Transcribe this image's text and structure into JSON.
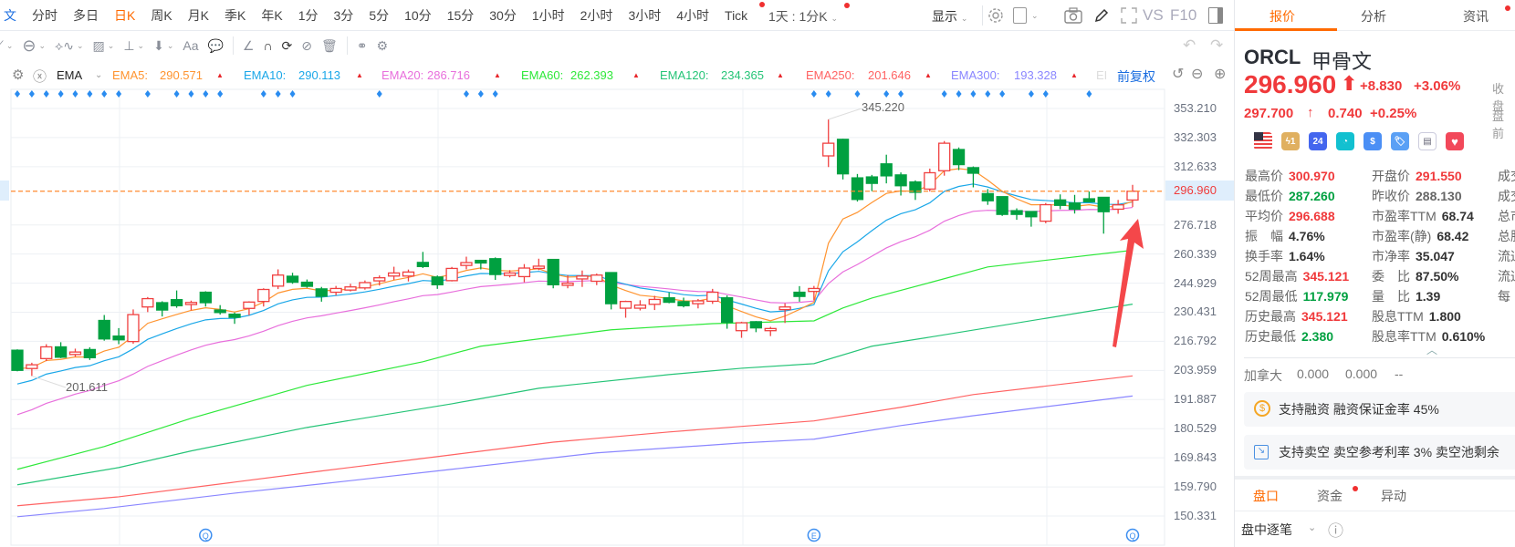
{
  "topbar": {
    "periods": [
      "文",
      "分时",
      "多日",
      "日K",
      "周K",
      "月K",
      "季K",
      "年K",
      "1分",
      "3分",
      "5分",
      "10分",
      "15分",
      "30分",
      "1小时",
      "2小时",
      "3小时",
      "4小时",
      "Tick"
    ],
    "active": "日K",
    "session": "1天 : 1分K",
    "display_label": "显示",
    "vs_label": "VS",
    "f10_label": "F10"
  },
  "toolbar": {
    "text_tool": "Aa"
  },
  "ema_legend": {
    "indicator": "EMA",
    "items": [
      {
        "label": "EMA5:",
        "value": "290.571",
        "color": "#ff9430"
      },
      {
        "label": "EMA10:",
        "value": "290.113",
        "color": "#1aa7e8"
      },
      {
        "label": "EMA20:",
        "value": "286.716",
        "color": "#e86fdc"
      },
      {
        "label": "EMA60:",
        "value": "262.393",
        "color": "#2ee83a"
      },
      {
        "label": "EMA120:",
        "value": "234.365",
        "color": "#25c477"
      },
      {
        "label": "EMA250:",
        "value": "201.646",
        "color": "#ff6262"
      },
      {
        "label": "EMA300:",
        "value": "193.328",
        "color": "#8a86ff"
      }
    ],
    "truncated": "EI",
    "adjust_label": "前复权"
  },
  "chart_data": {
    "type": "candlestick",
    "y_scale": "log",
    "ylim": [
      150.331,
      353.21
    ],
    "y_ticks": [
      "353.210",
      "332.303",
      "312.633",
      "276.718",
      "260.339",
      "244.929",
      "230.431",
      "216.792",
      "203.959",
      "191.887",
      "180.529",
      "169.843",
      "159.790",
      "150.331"
    ],
    "current_price": "296.960",
    "high_label": "345.220",
    "low_label": "201.611",
    "colors": {
      "up": "#f04040",
      "down": "#00a040",
      "current_line": "#ff8a30"
    },
    "candles_ohlc": [
      [
        212.8,
        213.2,
        203.6,
        204.0
      ],
      [
        204.8,
        207.3,
        201.611,
        206.4
      ],
      [
        209.1,
        215.5,
        208.0,
        214.3
      ],
      [
        214.3,
        216.4,
        209.3,
        209.7
      ],
      [
        210.9,
        213.5,
        209.9,
        212.0
      ],
      [
        213.1,
        214.1,
        208.5,
        209.5
      ],
      [
        226.5,
        229.1,
        217.1,
        217.9
      ],
      [
        219.2,
        222.9,
        215.5,
        217.5
      ],
      [
        216.7,
        231.8,
        215.7,
        229.3
      ],
      [
        233.0,
        237.9,
        230.5,
        237.1
      ],
      [
        235.1,
        235.8,
        228.4,
        231.5
      ],
      [
        236.6,
        241.2,
        232.6,
        233.6
      ],
      [
        234.2,
        236.1,
        231.3,
        235.2
      ],
      [
        240.3,
        240.8,
        233.2,
        235.1
      ],
      [
        231.5,
        233.9,
        229.3,
        230.3
      ],
      [
        229.5,
        230.3,
        224.9,
        228.0
      ],
      [
        232.3,
        235.8,
        229.0,
        235.4
      ],
      [
        235.7,
        242.3,
        233.2,
        241.7
      ],
      [
        243.4,
        252.1,
        241.9,
        249.1
      ],
      [
        248.5,
        250.3,
        244.6,
        245.4
      ],
      [
        245.4,
        246.8,
        242.6,
        243.3
      ],
      [
        242.0,
        243.0,
        235.6,
        238.3
      ],
      [
        240.3,
        243.5,
        238.7,
        242.2
      ],
      [
        241.4,
        244.6,
        240.7,
        243.0
      ],
      [
        242.5,
        246.3,
        241.6,
        245.2
      ],
      [
        246.1,
        248.9,
        243.7,
        247.7
      ],
      [
        248.6,
        253.5,
        246.6,
        250.2
      ],
      [
        248.6,
        252.0,
        245.8,
        250.7
      ],
      [
        255.8,
        261.5,
        252.8,
        253.6
      ],
      [
        248.1,
        248.9,
        242.0,
        244.1
      ],
      [
        246.2,
        253.4,
        245.8,
        252.6
      ],
      [
        254.2,
        258.9,
        252.1,
        255.7
      ],
      [
        256.9,
        256.9,
        252.1,
        255.5
      ],
      [
        257.8,
        258.5,
        246.6,
        249.4
      ],
      [
        248.9,
        251.7,
        247.9,
        250.2
      ],
      [
        248.3,
        254.9,
        245.4,
        252.8
      ],
      [
        252.6,
        257.8,
        251.7,
        253.8
      ],
      [
        257.4,
        257.6,
        242.3,
        244.1
      ],
      [
        243.8,
        249.1,
        242.3,
        244.9
      ],
      [
        247.1,
        251.5,
        243.0,
        248.6
      ],
      [
        245.9,
        249.9,
        243.9,
        249.1
      ],
      [
        250.4,
        250.4,
        231.8,
        234.6
      ],
      [
        232.4,
        236.1,
        227.8,
        235.7
      ],
      [
        232.4,
        236.3,
        231.3,
        233.9
      ],
      [
        234.3,
        238.5,
        231.5,
        236.7
      ],
      [
        237.5,
        240.2,
        234.8,
        235.3
      ],
      [
        235.6,
        237.6,
        232.8,
        233.6
      ],
      [
        234.6,
        236.9,
        232.3,
        236.0
      ],
      [
        235.8,
        242.0,
        234.5,
        240.3
      ],
      [
        237.5,
        238.7,
        222.6,
        225.6
      ],
      [
        221.7,
        225.9,
        218.4,
        225.4
      ],
      [
        225.9,
        226.2,
        221.0,
        223.0
      ],
      [
        221.7,
        223.5,
        219.2,
        222.7
      ],
      [
        231.7,
        234.8,
        225.3,
        233.0
      ],
      [
        240.3,
        243.4,
        235.6,
        238.2
      ],
      [
        240.7,
        243.5,
        236.3,
        242.2
      ],
      [
        319.8,
        345.22,
        312.4,
        328.4
      ],
      [
        331.1,
        331.5,
        304.4,
        308.0
      ],
      [
        305.4,
        307.9,
        290.6,
        291.9
      ],
      [
        306.0,
        307.3,
        297.0,
        301.9
      ],
      [
        314.5,
        320.6,
        301.9,
        306.7
      ],
      [
        307.3,
        308.9,
        294.3,
        300.4
      ],
      [
        302.8,
        303.8,
        291.6,
        296.3
      ],
      [
        298.3,
        311.4,
        296.8,
        308.7
      ],
      [
        310.0,
        329.9,
        306.8,
        328.4
      ],
      [
        324.1,
        325.5,
        310.4,
        314.0
      ],
      [
        312.0,
        312.8,
        299.4,
        308.4
      ],
      [
        295.5,
        298.3,
        288.6,
        291.1
      ],
      [
        293.6,
        293.6,
        282.0,
        282.9
      ],
      [
        285.1,
        286.5,
        279.7,
        282.9
      ],
      [
        284.6,
        284.6,
        275.7,
        281.5
      ],
      [
        278.9,
        289.7,
        277.7,
        288.7
      ],
      [
        291.6,
        295.0,
        286.0,
        288.3
      ],
      [
        289.7,
        294.7,
        283.4,
        286.0
      ],
      [
        292.3,
        296.8,
        290.5,
        290.5
      ],
      [
        293.2,
        293.2,
        271.7,
        284.5
      ],
      [
        286.0,
        291.6,
        283.3,
        288.6
      ],
      [
        291.55,
        300.97,
        287.26,
        296.96
      ]
    ],
    "ema_short_seeds": {
      "EMA5": 205,
      "EMA10": 197,
      "EMA20": 184
    },
    "ema_long_knots": {
      "EMA60": [
        [
          0,
          165.8
        ],
        [
          6,
          173.9
        ],
        [
          12,
          184.5
        ],
        [
          20,
          197.7
        ],
        [
          28,
          207.7
        ],
        [
          32,
          214.6
        ],
        [
          41,
          222.1
        ],
        [
          48,
          225.0
        ],
        [
          55,
          226.3
        ],
        [
          57,
          232.5
        ],
        [
          59,
          237.4
        ],
        [
          63,
          245.2
        ],
        [
          67,
          253.4
        ],
        [
          77,
          262.393
        ]
      ],
      "EMA120": [
        [
          0,
          160.5
        ],
        [
          7,
          166.4
        ],
        [
          12,
          172.3
        ],
        [
          20,
          181.0
        ],
        [
          30,
          190.2
        ],
        [
          36,
          196.5
        ],
        [
          45,
          202.2
        ],
        [
          50,
          204.9
        ],
        [
          55,
          206.9
        ],
        [
          59,
          214.6
        ],
        [
          63,
          218.7
        ],
        [
          77,
          234.365
        ]
      ],
      "EMA250": [
        [
          0,
          153.6
        ],
        [
          7,
          156.5
        ],
        [
          15,
          161.4
        ],
        [
          21,
          165.2
        ],
        [
          30,
          170.9
        ],
        [
          37,
          175.5
        ],
        [
          45,
          179.3
        ],
        [
          55,
          183.5
        ],
        [
          61,
          188.8
        ],
        [
          66,
          193.9
        ],
        [
          77,
          201.646
        ]
      ],
      "EMA300": [
        [
          0,
          150.1
        ],
        [
          6,
          152.7
        ],
        [
          15,
          157.7
        ],
        [
          21,
          160.8
        ],
        [
          30,
          165.8
        ],
        [
          40,
          171.6
        ],
        [
          50,
          175.2
        ],
        [
          55,
          176.6
        ],
        [
          61,
          181.7
        ],
        [
          66,
          185.5
        ],
        [
          77,
          193.328
        ]
      ]
    },
    "event_marker_candles": [
      0,
      1,
      2,
      3,
      4,
      5,
      6,
      7,
      9,
      11,
      12,
      13,
      14,
      17,
      18,
      19,
      25,
      31,
      32,
      33,
      55,
      56,
      58,
      60,
      61,
      64,
      65,
      66,
      67,
      68,
      70,
      71,
      74
    ],
    "bottom_markers": [
      {
        "candle": 13,
        "letter": "Q"
      },
      {
        "candle": 55,
        "letter": "E"
      },
      {
        "candle": 77,
        "letter": "Q"
      }
    ]
  },
  "quote": {
    "tabs": [
      "报价",
      "分析",
      "资讯"
    ],
    "symbol": "ORCL",
    "name": "甲骨文",
    "price": "296.960",
    "change": "+8.830",
    "change_pct": "+3.06%",
    "close_label": "收盘",
    "pre_price": "297.700",
    "pre_change": "0.740",
    "pre_change_pct": "+0.25%",
    "pre_label": "盘前",
    "badges": [
      "us-flag",
      "lightning-1",
      "24h",
      "chart-circle",
      "dollar",
      "tag",
      "bookmark",
      "heart"
    ],
    "stats_col1": [
      {
        "label": "最高价",
        "value": "300.970",
        "tone": "red"
      },
      {
        "label": "最低价",
        "value": "287.260",
        "tone": "green"
      },
      {
        "label": "平均价",
        "value": "296.688",
        "tone": "red"
      },
      {
        "label": "振　幅",
        "value": "4.76%",
        "tone": "dark"
      },
      {
        "label": "换手率",
        "value": "1.64%",
        "tone": "dark"
      },
      {
        "label": "52周最高",
        "value": "345.121",
        "tone": "red"
      },
      {
        "label": "52周最低",
        "value": "117.979",
        "tone": "green"
      },
      {
        "label": "历史最高",
        "value": "345.121",
        "tone": "red"
      },
      {
        "label": "历史最低",
        "value": "2.380",
        "tone": "green"
      }
    ],
    "stats_col2": [
      {
        "label": "开盘价",
        "value": "291.550",
        "tone": "red"
      },
      {
        "label": "昨收价",
        "value": "288.130",
        "tone": "grey"
      },
      {
        "label": "市盈率TTM",
        "value": "68.74",
        "tone": "dark"
      },
      {
        "label": "市盈率(静)",
        "value": "68.42",
        "tone": "dark"
      },
      {
        "label": "市净率",
        "value": "35.047",
        "tone": "dark"
      },
      {
        "label": "委　比",
        "value": "87.50%",
        "tone": "dark"
      },
      {
        "label": "量　比",
        "value": "1.39",
        "tone": "dark"
      },
      {
        "label": "股息TTM",
        "value": "1.800",
        "tone": "dark"
      },
      {
        "label": "股息率TTM",
        "value": "0.610%",
        "tone": "dark"
      }
    ],
    "stats_col3": [
      "成交",
      "成交",
      "总市",
      "总股",
      "流通",
      "流通",
      "每"
    ],
    "canada": {
      "label": "加拿大",
      "v1": "0.000",
      "v2": "0.000",
      "v3": "--"
    },
    "margin_text": "支持融资 融资保证金率 45%",
    "short_text": "支持卖空 卖空参考利率 3% 卖空池剩余",
    "bottom_tabs": [
      "盘口",
      "资金",
      "异动"
    ],
    "tick_label": "盘中逐笔"
  }
}
